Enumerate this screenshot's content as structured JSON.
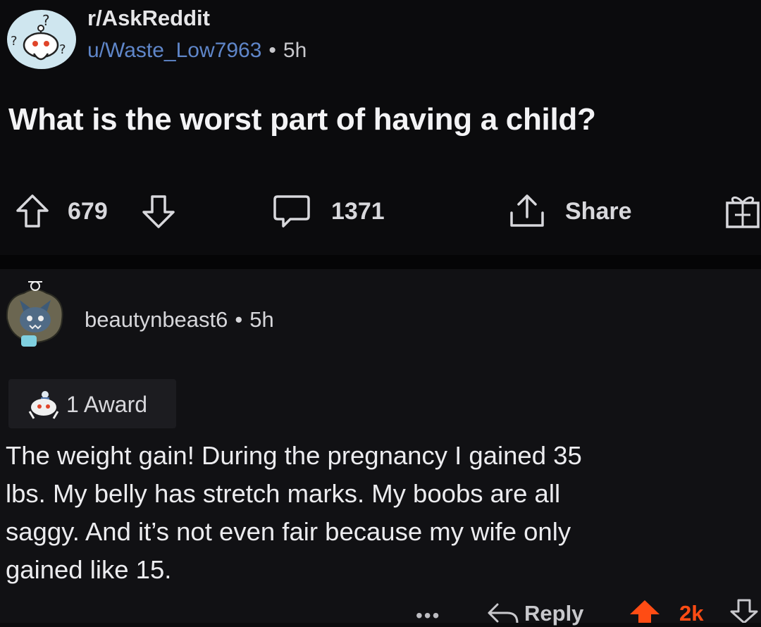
{
  "post": {
    "subreddit": "r/AskReddit",
    "author": "u/Waste_Low7963",
    "separator": "•",
    "age": "5h",
    "title": "What is the worst part of having a child?",
    "upvotes": "679",
    "comments": "1371",
    "share_label": "Share",
    "icons": [
      "snoo-avatar-icon",
      "upvote-arrow-icon",
      "downvote-arrow-icon",
      "comment-bubble-icon",
      "share-icon",
      "gift-award-icon"
    ]
  },
  "comment": {
    "username": "beautynbeast6",
    "separator": "•",
    "age": "5h",
    "award_label": "1 Award",
    "body_lines": [
      "The weight gain! During the pregnancy I gained 35",
      "lbs. My belly has stretch marks. My boobs are all",
      "saggy. And it’s not even fair because my wife only",
      "gained like 15."
    ],
    "more_label": "•••",
    "reply_label": "Reply",
    "score": "2k",
    "colors": {
      "upvoted": "#ff4c14",
      "author_link": "#5f86c9",
      "background": "#0b0b0d"
    }
  }
}
